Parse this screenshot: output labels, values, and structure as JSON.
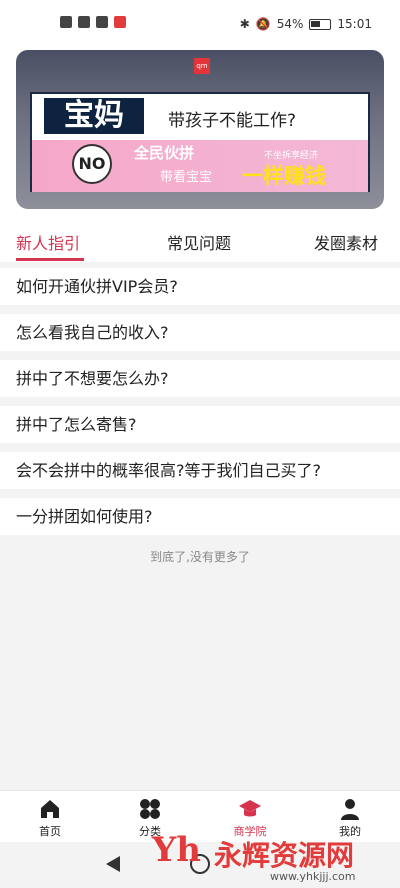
{
  "status_bar": {
    "battery": "54%",
    "time": "15:01"
  },
  "banner": {
    "brand": "qm",
    "main_title": "宝妈",
    "tagline": "带孩子不能工作?",
    "no_badge": "NO",
    "promo1": "全民伙拼",
    "promo2": "不坐拆享经济",
    "promo3": "带看宝宝",
    "promo4": "一样赚钱"
  },
  "tabs": [
    "新人指引",
    "常见问题",
    "发圈素材"
  ],
  "faq": [
    "如何开通伙拼VIP会员?",
    "怎么看我自己的收入?",
    "拼中了不想要怎么办?",
    "拼中了怎么寄售?",
    "会不会拼中的概率很高?等于我们自己买了?",
    "一分拼团如何使用?"
  ],
  "end_text": "到底了,没有更多了",
  "tabbar": [
    "首页",
    "分类",
    "商学院",
    "我的"
  ],
  "watermark": {
    "name": "永辉资源网",
    "url": "www.yhkjjj.com"
  },
  "colors": {
    "accent": "#d6334f",
    "background": "#f3f3f3"
  }
}
